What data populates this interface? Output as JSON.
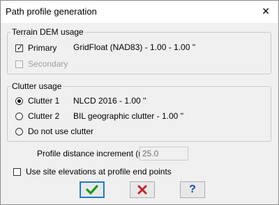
{
  "window": {
    "title": "Path profile generation",
    "close_glyph": "✕"
  },
  "terrain": {
    "legend": "Terrain DEM usage",
    "primary": {
      "label": "Primary",
      "checked": true,
      "value": "GridFloat (NAD83) - 1.00 - 1.00 ''"
    },
    "secondary": {
      "label": "Secondary",
      "checked": false,
      "enabled": false
    }
  },
  "clutter": {
    "legend": "Clutter usage",
    "options": [
      {
        "label": "Clutter 1",
        "value": "NLCD 2016 - 1.00 ''",
        "selected": true
      },
      {
        "label": "Clutter 2",
        "value": "BIL geographic clutter - 1.00 ''",
        "selected": false
      },
      {
        "label": "Do not use clutter",
        "value": "",
        "selected": false
      }
    ]
  },
  "increment": {
    "label": "Profile distance increment (m)",
    "value": "25.0"
  },
  "site_elev": {
    "label": "Use site elevations at profile end points",
    "checked": false
  },
  "buttons": {
    "ok": "ok-check",
    "cancel": "cancel-x",
    "help": "?"
  },
  "colors": {
    "ok_green": "#1a9b1a",
    "cancel_red": "#c0262d",
    "help_blue": "#1f4aa8"
  }
}
